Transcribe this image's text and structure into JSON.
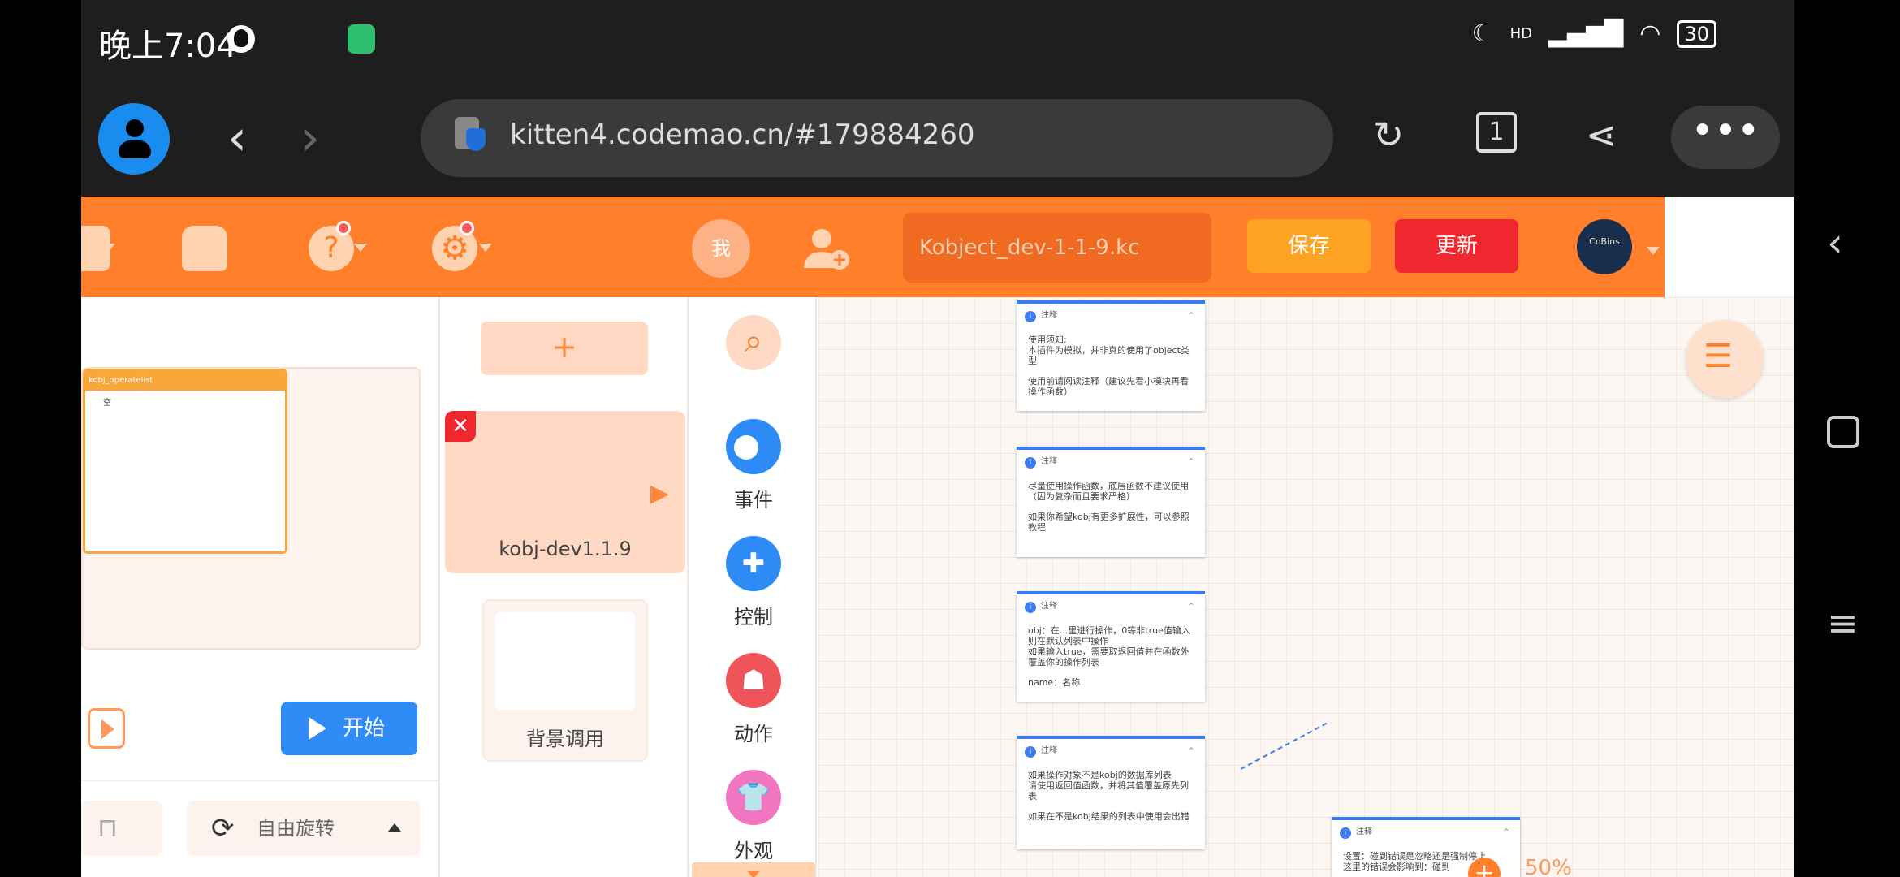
{
  "status_bar": {
    "time": "晚上7:04",
    "hd": "HD",
    "battery": "30"
  },
  "browser": {
    "url": "kitten4.codemao.cn/#179884260",
    "tab_count": "1"
  },
  "app_bar": {
    "me_label": "我",
    "project_name": "Kobject_dev-1-1-9.kc",
    "save_label": "保存",
    "update_label": "更新",
    "avatar_text": "CoBins"
  },
  "stage": {
    "list_widget_title": "kobj_operatelist",
    "list_widget_row": "空",
    "start_label": "开始",
    "rotate_label": "自由旋转"
  },
  "actors": {
    "add_label": "+",
    "items": [
      {
        "name": "kobj-dev1.1.9"
      },
      {
        "name": "背景调用"
      }
    ]
  },
  "categories": [
    {
      "label": "",
      "icon": "search-icon",
      "color": "#ffd9c4"
    },
    {
      "label": "事件",
      "icon": "toggle-icon",
      "color": "#2f8bf6"
    },
    {
      "label": "控制",
      "icon": "gamepad-icon",
      "color": "#2f8bf6"
    },
    {
      "label": "动作",
      "icon": "ghost-icon",
      "color": "#f0545b"
    },
    {
      "label": "外观",
      "icon": "shirt-icon",
      "color": "#f275c1"
    }
  ],
  "workspace": {
    "zoom": "50%",
    "notes": [
      {
        "title": "注释",
        "lines": [
          "使用须知:",
          "本插件为模拟，并非真的使用了object类型",
          "使用前请阅读注释（建议先看小模块再看操作函数）"
        ]
      },
      {
        "title": "注释",
        "lines": [
          "尽量使用操作函数，底层函数不建议使用（因为复杂而且要求严格）",
          "如果你希望kobj有更多扩展性，可以参照教程"
        ]
      },
      {
        "title": "注释",
        "lines": [
          "obj：在...里进行操作，0等非true值输入则在默认列表中操作",
          "如果输入true，需要取返回值并在函数外覆盖你的操作列表",
          "name：名称"
        ]
      },
      {
        "title": "注释",
        "lines": [
          "如果操作对象不是kobj的数据库列表",
          "请使用返回值函数，并将其值覆盖原先列表",
          "如果在不是kobj结果的列表中使用会出错"
        ]
      },
      {
        "title": "注释",
        "lines": [
          "设置：碰到错误是忽略还是强制停止",
          "这里的错误会影响到：碰到"
        ]
      }
    ]
  }
}
